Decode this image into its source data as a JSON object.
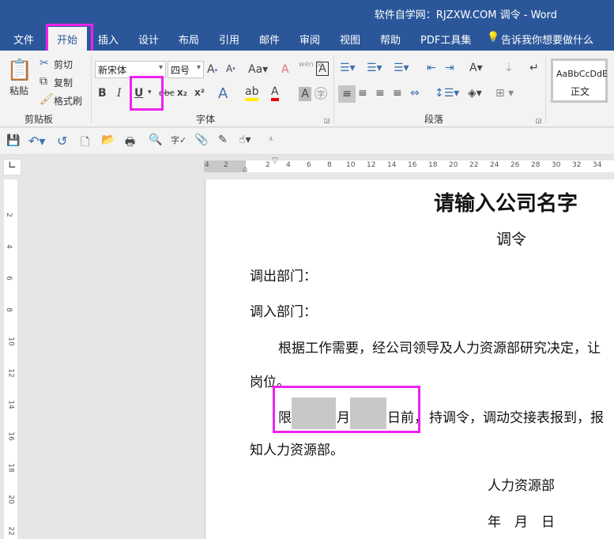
{
  "window": {
    "title": "软件自学网：RJZXW.COM  调令  -  Word"
  },
  "tabs": [
    {
      "label": "文件"
    },
    {
      "label": "开始"
    },
    {
      "label": "插入"
    },
    {
      "label": "设计"
    },
    {
      "label": "布局"
    },
    {
      "label": "引用"
    },
    {
      "label": "邮件"
    },
    {
      "label": "审阅"
    },
    {
      "label": "视图"
    },
    {
      "label": "帮助"
    },
    {
      "label": "PDF工具集"
    },
    {
      "label": "告诉我你想要做什么"
    }
  ],
  "ribbon": {
    "clipboard": {
      "paste": "粘贴",
      "cut": "剪切",
      "copy": "复制",
      "format_painter": "格式刷",
      "group": "剪贴板"
    },
    "font": {
      "name": "新宋体",
      "size": "四号",
      "bold": "B",
      "italic": "I",
      "underline": "U",
      "group": "字体",
      "phonetic": "wén 文"
    },
    "paragraph": {
      "group": "段落"
    },
    "styles": {
      "preview": "AaBbCcDdE",
      "normal": "正文"
    }
  },
  "ruler": {
    "h": [
      "4",
      "2",
      "2",
      "4",
      "6",
      "8",
      "10",
      "12",
      "14",
      "16",
      "18",
      "20",
      "22",
      "24",
      "26",
      "28",
      "30",
      "32",
      "34"
    ],
    "v": [
      "2",
      "4",
      "6",
      "8",
      "10",
      "12",
      "14",
      "16",
      "18",
      "20",
      "22"
    ]
  },
  "document": {
    "title": "请输入公司名字",
    "subtitle": "调令",
    "out_dept": "调出部门：",
    "in_dept": "调入部门：",
    "para1": "根据工作需要，经公司领导及人力资源部研究决定，让",
    "para1b": "岗位。",
    "limit": "限",
    "month": "月",
    "before": "日前，",
    "para2": "持调令，调动交接表报到，报",
    "para2b": "知人力资源部。",
    "sign": "人力资源部",
    "date": "年　月　日"
  }
}
